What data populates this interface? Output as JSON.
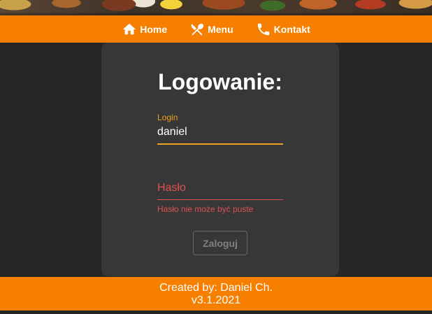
{
  "nav": {
    "items": [
      {
        "label": "Home",
        "icon": "home-icon"
      },
      {
        "label": "Menu",
        "icon": "cutlery-icon"
      },
      {
        "label": "Kontakt",
        "icon": "phone-icon"
      }
    ]
  },
  "login_form": {
    "title": "Logowanie:",
    "login": {
      "label": "Login",
      "value": "daniel"
    },
    "password": {
      "placeholder": "Hasło",
      "value": "",
      "error": "Hasło nie może być puste"
    },
    "submit_label": "Zaloguj"
  },
  "footer": {
    "line1": "Created by: Daniel Ch.",
    "line2": "v3.1.2021"
  },
  "colors": {
    "accent": "#f77f00",
    "field_focus": "#f0a020",
    "error": "#e05050",
    "card": "#373737",
    "background": "#262626"
  }
}
